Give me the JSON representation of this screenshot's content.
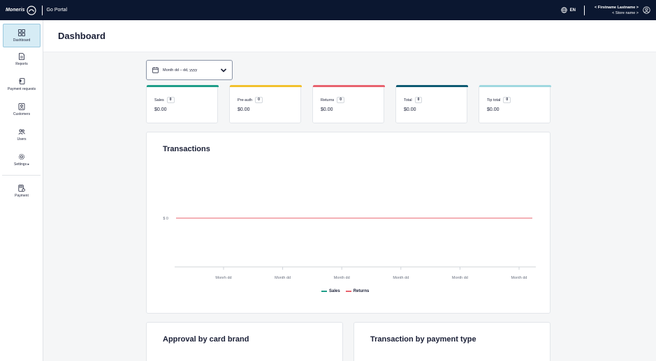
{
  "topbar": {
    "brand_word": "Moneris",
    "product": "Go Portal",
    "lang": "EN",
    "user_name": "< Firstname Lastname >",
    "store_name": "< Store name >"
  },
  "sidebar": {
    "items": [
      {
        "label": "Dashboard",
        "icon": "dashboard-icon",
        "active": true
      },
      {
        "label": "Reports",
        "icon": "reports-icon"
      },
      {
        "label": "Payment requests",
        "icon": "payment-requests-icon"
      },
      {
        "label": "Customers",
        "icon": "customers-icon"
      },
      {
        "label": "Users",
        "icon": "users-icon"
      },
      {
        "label": "Settings ▸",
        "icon": "gear-icon"
      },
      {
        "label": "Payment",
        "icon": "payment-icon"
      }
    ]
  },
  "page": {
    "title": "Dashboard"
  },
  "date_picker": {
    "value": "Month dd – dd, yyyy"
  },
  "cards": [
    {
      "label": "Sales",
      "count": "0",
      "amount": "$0.00",
      "color": "#1f9e89"
    },
    {
      "label": "Pre-auth",
      "count": "0",
      "amount": "$0.00",
      "color": "#f2c12e"
    },
    {
      "label": "Returns",
      "count": "0",
      "amount": "$0.00",
      "color": "#e8636e"
    },
    {
      "label": "Total",
      "count": "0",
      "amount": "$0.00",
      "color": "#0f5b73"
    },
    {
      "label": "Tip total",
      "count": "0",
      "amount": "$0.00",
      "color": "#9fd8e0"
    }
  ],
  "transactions_panel": {
    "title": "Transactions"
  },
  "chart_data": {
    "type": "line",
    "categories": [
      "Monrh dd",
      "Month dd",
      "Month dd",
      "Month dd",
      "Month dd",
      "Month dd"
    ],
    "series": [
      {
        "name": "Sales",
        "values": [
          0,
          0,
          0,
          0,
          0,
          0
        ],
        "color": "#1f9e89"
      },
      {
        "name": "Returns",
        "values": [
          0,
          0,
          0,
          0,
          0,
          0
        ],
        "color": "#e8636e"
      }
    ],
    "y_tick_labels": [
      "$ 0"
    ],
    "legend_position": "bottom-center",
    "grid": false
  },
  "panels": {
    "approval_title": "Approval by card brand",
    "payment_type_title": "Transaction by payment type"
  }
}
